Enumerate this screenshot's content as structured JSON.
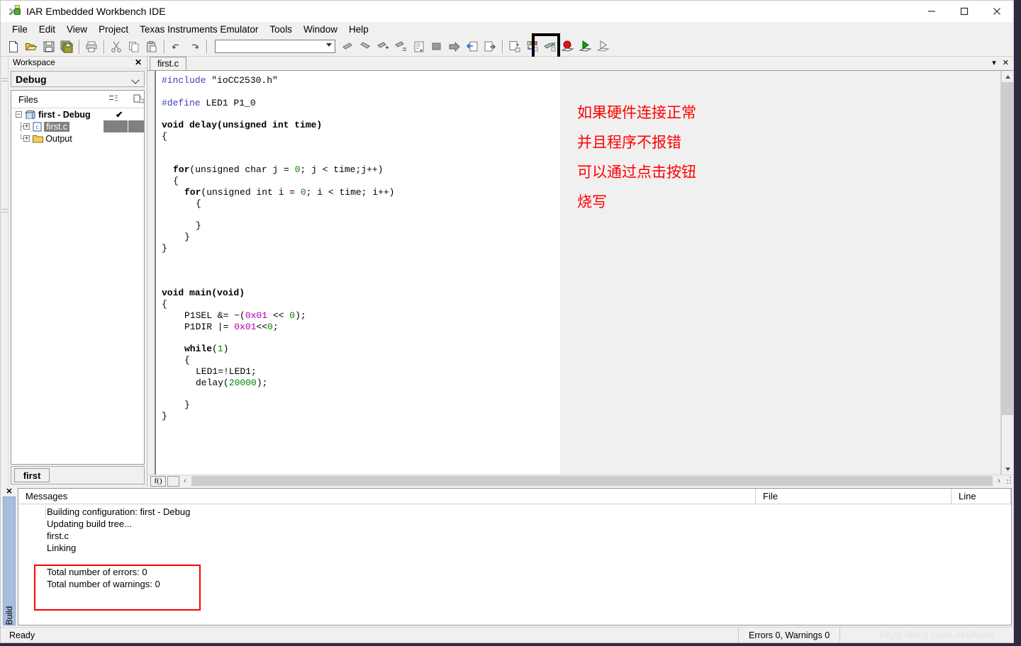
{
  "window": {
    "title": "IAR Embedded Workbench IDE",
    "icon": "iar-app-icon",
    "minimize": "—",
    "maximize": "□",
    "close": "✕"
  },
  "menu": {
    "items": [
      {
        "label": "File"
      },
      {
        "label": "Edit"
      },
      {
        "label": "View"
      },
      {
        "label": "Project"
      },
      {
        "label": "Texas Instruments Emulator"
      },
      {
        "label": "Tools"
      },
      {
        "label": "Window"
      },
      {
        "label": "Help"
      }
    ]
  },
  "toolbar": {
    "combo_value": "",
    "buttons": [
      {
        "name": "new-document-icon"
      },
      {
        "name": "open-folder-icon"
      },
      {
        "name": "save-icon"
      },
      {
        "name": "save-all-icon"
      },
      {
        "name": "print-icon"
      },
      {
        "name": "cut-icon"
      },
      {
        "name": "copy-icon"
      },
      {
        "name": "paste-icon"
      },
      {
        "name": "undo-icon"
      },
      {
        "name": "redo-icon"
      },
      {
        "name": "find-previous-icon"
      },
      {
        "name": "find-next-icon"
      },
      {
        "name": "bookmark-toggle-icon"
      },
      {
        "name": "bookmark-clear-icon"
      },
      {
        "name": "compile-icon"
      },
      {
        "name": "make-icon"
      },
      {
        "name": "stop-build-icon"
      },
      {
        "name": "debug-without-download-icon"
      },
      {
        "name": "next-statement-icon"
      },
      {
        "name": "go-to-definition-icon"
      },
      {
        "name": "breakpoints-icon"
      },
      {
        "name": "disable-debug-icon"
      },
      {
        "name": "stop-debug-icon"
      },
      {
        "name": "download-and-debug-icon"
      },
      {
        "name": "debug-without-downloading-icon"
      }
    ]
  },
  "workspace": {
    "panel_title": "Workspace",
    "close_label": "✕",
    "config": "Debug",
    "files_header": "Files",
    "tree": [
      {
        "label": "first - Debug",
        "icon": "project-icon",
        "check": "✔",
        "expander": "−",
        "selected": false,
        "indent": 0
      },
      {
        "label": "first.c",
        "icon": "c-file-icon",
        "check": "",
        "expander": "+",
        "selected": true,
        "indent": 1
      },
      {
        "label": "Output",
        "icon": "folder-icon",
        "check": "",
        "expander": "+",
        "selected": false,
        "indent": 1
      }
    ],
    "tabs": [
      {
        "label": "first"
      }
    ]
  },
  "editor": {
    "tabs": [
      {
        "label": "first.c",
        "active": true
      }
    ],
    "dropdown_icon": "▾",
    "close_icon": "✕",
    "goto_function_label": "f()",
    "hscroll_left": "‹",
    "hscroll_right": "›",
    "code_lines": [
      {
        "indent": 0,
        "tokens": [
          {
            "t": "#include",
            "c": "k-pre"
          },
          {
            "t": " \"ioCC2530.h\"",
            "c": ""
          }
        ]
      },
      {
        "indent": 0,
        "tokens": []
      },
      {
        "indent": 0,
        "tokens": [
          {
            "t": "#define",
            "c": "k-pre"
          },
          {
            "t": " LED1 P1_0",
            "c": ""
          }
        ]
      },
      {
        "indent": 0,
        "tokens": []
      },
      {
        "indent": 0,
        "tokens": [
          {
            "t": "void delay(unsigned int time)",
            "c": "k-bold"
          }
        ]
      },
      {
        "indent": 0,
        "tokens": [
          {
            "t": "{",
            "c": ""
          }
        ]
      },
      {
        "indent": 0,
        "tokens": []
      },
      {
        "indent": 0,
        "tokens": []
      },
      {
        "indent": 1,
        "tokens": [
          {
            "t": "for",
            "c": "k-bold"
          },
          {
            "t": "(unsigned char j = ",
            "c": ""
          },
          {
            "t": "0",
            "c": "k-num"
          },
          {
            "t": "; j < time;j++)",
            "c": ""
          }
        ]
      },
      {
        "indent": 1,
        "tokens": [
          {
            "t": "{",
            "c": ""
          }
        ]
      },
      {
        "indent": 2,
        "tokens": [
          {
            "t": "for",
            "c": "k-bold"
          },
          {
            "t": "(unsigned int i = ",
            "c": ""
          },
          {
            "t": "0",
            "c": "k-num"
          },
          {
            "t": "; i < time; i++)",
            "c": ""
          }
        ]
      },
      {
        "indent": 3,
        "tokens": [
          {
            "t": "{",
            "c": ""
          }
        ]
      },
      {
        "indent": 0,
        "tokens": []
      },
      {
        "indent": 3,
        "tokens": [
          {
            "t": "}",
            "c": ""
          }
        ]
      },
      {
        "indent": 2,
        "tokens": [
          {
            "t": "}",
            "c": ""
          }
        ]
      },
      {
        "indent": 0,
        "tokens": [
          {
            "t": "}",
            "c": ""
          }
        ]
      },
      {
        "indent": 0,
        "tokens": []
      },
      {
        "indent": 0,
        "tokens": []
      },
      {
        "indent": 0,
        "tokens": []
      },
      {
        "indent": 0,
        "tokens": [
          {
            "t": "void main(void)",
            "c": "k-bold"
          }
        ]
      },
      {
        "indent": 0,
        "tokens": [
          {
            "t": "{",
            "c": ""
          }
        ]
      },
      {
        "indent": 2,
        "tokens": [
          {
            "t": "P1SEL &= ~(",
            "c": ""
          },
          {
            "t": "0x01",
            "c": "k-hex"
          },
          {
            "t": " << ",
            "c": ""
          },
          {
            "t": "0",
            "c": "k-num"
          },
          {
            "t": ");",
            "c": ""
          }
        ]
      },
      {
        "indent": 2,
        "tokens": [
          {
            "t": "P1DIR |= ",
            "c": ""
          },
          {
            "t": "0x01",
            "c": "k-hex"
          },
          {
            "t": "<<",
            "c": ""
          },
          {
            "t": "0",
            "c": "k-num"
          },
          {
            "t": ";",
            "c": ""
          }
        ]
      },
      {
        "indent": 0,
        "tokens": []
      },
      {
        "indent": 2,
        "tokens": [
          {
            "t": "while",
            "c": "k-bold"
          },
          {
            "t": "(",
            "c": ""
          },
          {
            "t": "1",
            "c": "k-num"
          },
          {
            "t": ")",
            "c": ""
          }
        ]
      },
      {
        "indent": 2,
        "tokens": [
          {
            "t": "{",
            "c": ""
          }
        ]
      },
      {
        "indent": 3,
        "tokens": [
          {
            "t": "LED1=!LED1;",
            "c": ""
          }
        ]
      },
      {
        "indent": 3,
        "tokens": [
          {
            "t": "delay(",
            "c": ""
          },
          {
            "t": "20000",
            "c": "k-num"
          },
          {
            "t": ");",
            "c": ""
          }
        ]
      },
      {
        "indent": 0,
        "tokens": []
      },
      {
        "indent": 2,
        "tokens": [
          {
            "t": "}",
            "c": ""
          }
        ]
      },
      {
        "indent": 0,
        "tokens": [
          {
            "t": "}",
            "c": ""
          }
        ]
      }
    ]
  },
  "annotation": {
    "color": "#ff0000",
    "lines": [
      "如果硬件连接正常",
      "并且程序不报错",
      "可以通过点击按钮",
      "烧写"
    ]
  },
  "build_panel": {
    "close_label": "✕",
    "tab_label": "Build",
    "columns": [
      {
        "label": "Messages"
      },
      {
        "label": "File"
      },
      {
        "label": "Line"
      }
    ],
    "messages": [
      "Building configuration: first - Debug",
      "Updating build tree...",
      "first.c",
      "Linking"
    ],
    "summary": [
      "Total number of errors: 0",
      "Total number of warnings: 0"
    ],
    "highlight_color": "#ff0000"
  },
  "statusbar": {
    "left": "Ready",
    "errors_warnings": "Errors 0, Warnings 0",
    "watermark": "https://blog.csdn.net/Avicii"
  }
}
